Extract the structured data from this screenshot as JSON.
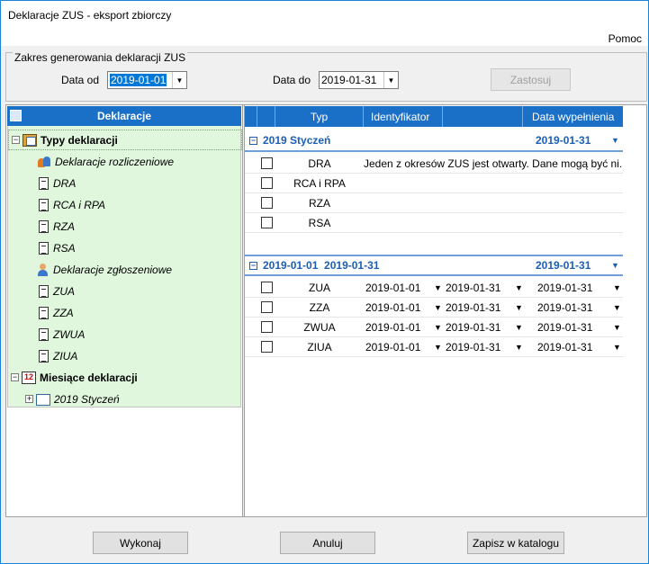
{
  "window": {
    "title": "Deklaracje ZUS - eksport zbiorczy",
    "help": "Pomoc"
  },
  "range": {
    "legend": "Zakres generowania deklaracji ZUS",
    "from_label": "Data od",
    "from_value": "2019-01-01",
    "to_label": "Data do",
    "to_value": "2019-01-31",
    "apply_label": "Zastosuj"
  },
  "tree": {
    "header": "Deklaracje",
    "types_root": "Typy deklaracji",
    "settlement_group": "Deklaracje rozliczeniowe",
    "settlement_items": [
      "DRA",
      "RCA i RPA",
      "RZA",
      "RSA"
    ],
    "registration_group": "Deklaracje zgłoszeniowe",
    "registration_items": [
      "ZUA",
      "ZZA",
      "ZWUA",
      "ZIUA"
    ],
    "months_root": "Miesiące deklaracji",
    "month_item": "2019 Styczeń"
  },
  "grid": {
    "columns": [
      "Typ",
      "Identyfikator",
      "Data wypełnienia"
    ],
    "group1": {
      "title": "2019 Styczeń",
      "date": "2019-01-31",
      "rows": [
        {
          "type": "DRA",
          "id": "Jeden z okresów ZUS jest otwarty. Dane mogą być ni..."
        },
        {
          "type": "RCA i RPA",
          "id": ""
        },
        {
          "type": "RZA",
          "id": ""
        },
        {
          "type": "RSA",
          "id": ""
        }
      ]
    },
    "group2": {
      "title": "2019-01-01  2019-01-31",
      "date": "2019-01-31",
      "rows": [
        {
          "type": "ZUA",
          "from": "2019-01-01",
          "to": "2019-01-31",
          "fill": "2019-01-31"
        },
        {
          "type": "ZZA",
          "from": "2019-01-01",
          "to": "2019-01-31",
          "fill": "2019-01-31"
        },
        {
          "type": "ZWUA",
          "from": "2019-01-01",
          "to": "2019-01-31",
          "fill": "2019-01-31"
        },
        {
          "type": "ZIUA",
          "from": "2019-01-01",
          "to": "2019-01-31",
          "fill": "2019-01-31"
        }
      ]
    }
  },
  "footer": {
    "execute": "Wykonaj",
    "cancel": "Anuluj",
    "save": "Zapisz w katalogu"
  },
  "colors": {
    "header_blue": "#1a6fc7",
    "tree_bg": "#e0f7de",
    "group_text": "#1a5fb4",
    "selection": "#0078d7"
  }
}
